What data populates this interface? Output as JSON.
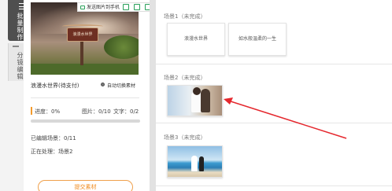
{
  "sidebar": {
    "tabs": [
      {
        "label": "批量制作",
        "active": true
      },
      {
        "label": "分镜编辑",
        "active": false
      }
    ]
  },
  "toolbar": {
    "send_label": "发送图片到手机"
  },
  "preview": {
    "sign_text": "浪漫水世界"
  },
  "project": {
    "title": "浪漫水世界(待支付)",
    "auto_switch_label": "自动切换素材",
    "progress_label": "进度：0%",
    "progress_fraction": 0,
    "pic_count": "图片：0/10",
    "text_count": "文字：0/2",
    "edited_scenes": "已编辑场景：0/11",
    "processing": "正在处理：场景2",
    "submit_label": "提交素材"
  },
  "scenes": [
    {
      "label": "场景1（未完成）",
      "items": [
        "浪漫水世界",
        "如水般温柔的一生"
      ]
    },
    {
      "label": "场景2（未完成）"
    },
    {
      "label": "场景3（未完成）"
    }
  ],
  "colors": {
    "accent": "#f39b2c",
    "arrow": "#e5282e",
    "tab_active": "#4f4f4f"
  }
}
